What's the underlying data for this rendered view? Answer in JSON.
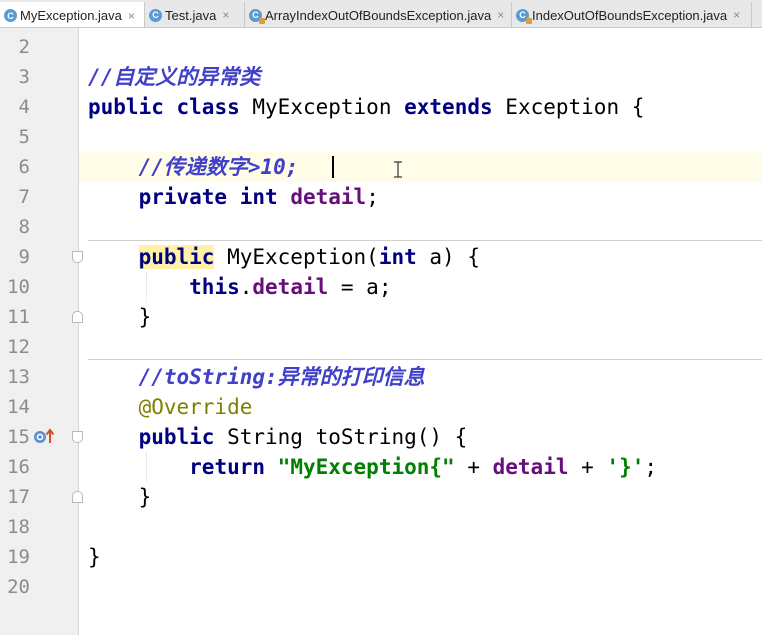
{
  "tabs": [
    {
      "label": "MyException.java",
      "close": "×",
      "icon": "class-icon",
      "active": true
    },
    {
      "label": "Test.java",
      "close": "×",
      "icon": "class-icon",
      "active": false
    },
    {
      "label": "ArrayIndexOutOfBoundsException.java",
      "close": "×",
      "icon": "library-class-icon",
      "active": false
    },
    {
      "label": "IndexOutOfBoundsException.java",
      "close": "×",
      "icon": "library-class-icon",
      "active": false
    }
  ],
  "line_numbers": [
    "2",
    "3",
    "4",
    "5",
    "6",
    "7",
    "8",
    "9",
    "10",
    "11",
    "12",
    "13",
    "14",
    "15",
    "16",
    "17",
    "18",
    "19",
    "20"
  ],
  "code": {
    "l3_comment": "//自定义的异常类",
    "l4_public": "public",
    "l4_class": "class",
    "l4_name": "MyException",
    "l4_extends": "extends",
    "l4_rest": "Exception {",
    "l6_comment": "//传递数字>10;",
    "l7_private": "private",
    "l7_int": "int",
    "l7_field": "detail",
    "l7_semi": ";",
    "l9_public": "public",
    "l9_name": "MyException(",
    "l9_int": "int",
    "l9_rest": "a) {",
    "l10_this": "this",
    "l10_dot": ".",
    "l10_field": "detail",
    "l10_rest": " = a;",
    "l11_brace": "}",
    "l13_comment": "//toString:异常的打印信息",
    "l14_annotation": "@Override",
    "l15_public": "public",
    "l15_rest": "String toString() {",
    "l16_return": "return",
    "l16_str": "\"MyException{\"",
    "l16_plus1": " + ",
    "l16_field": "detail",
    "l16_plus2": " + ",
    "l16_char": "'}'",
    "l16_semi": ";",
    "l17_brace": "}",
    "l19_brace": "}"
  },
  "colors": {
    "keyword": "#000080",
    "comment": "#4040c8",
    "field": "#660e7a",
    "string": "#008000",
    "annotation": "#808000",
    "caret_line": "#fffde7"
  }
}
